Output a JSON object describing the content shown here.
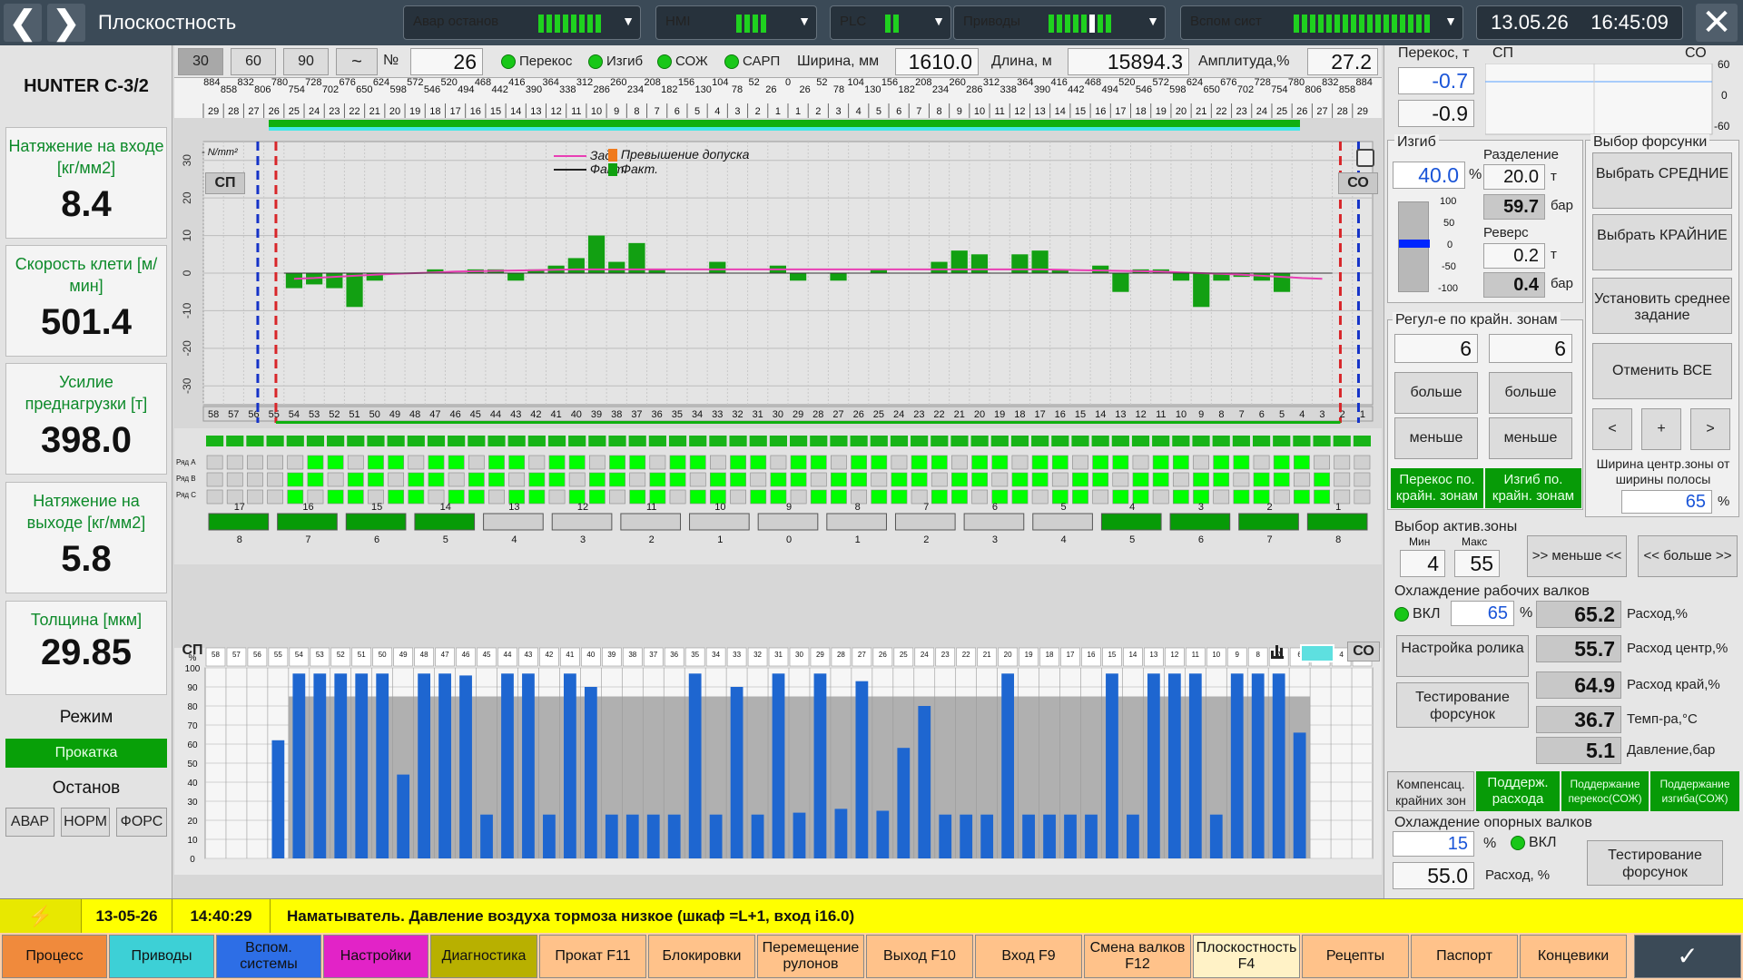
{
  "topbar": {
    "title": "Плоскостность",
    "stat_alarm": "Авар останов",
    "stat_hmi": "HMI",
    "stat_plc": "PLC",
    "stat_drives": "Приводы",
    "stat_aux": "Вспом сист",
    "date": "13.05.26",
    "time": "16:45:09"
  },
  "left": {
    "mill": "HUNTER C-3/2",
    "cards": [
      {
        "label": "Натяжение на входе [кг/мм2]",
        "value": "8.4"
      },
      {
        "label": "Скорость клети [м/мин]",
        "value": "501.4"
      },
      {
        "label": "Усилие преднагрузки [т]",
        "value": "398.0"
      },
      {
        "label": "Натяжение на выходе [кг/мм2]",
        "value": "5.8"
      },
      {
        "label": "Толщина [мкм]",
        "value": "29.85"
      }
    ],
    "mode_title": "Режим",
    "mode_value": "Прокатка",
    "stop_title": "Останов",
    "stop_buttons": [
      "АВАР",
      "НОРМ",
      "ФОРС"
    ]
  },
  "toolbar": {
    "b30": "30",
    "b60": "60",
    "b90": "90",
    "tilde": "~",
    "no_label": "№",
    "no_value": "26",
    "ind": [
      "Перекос",
      "Изгиб",
      "СОЖ",
      "САРП"
    ],
    "width_label": "Ширина, мм",
    "width_value": "1610.0",
    "length_label": "Длина, м",
    "length_value": "15894.3",
    "amp_label": "Амплитуда,%",
    "amp_value": "27.2"
  },
  "chart": {
    "sp": "СП",
    "so": "СО",
    "unit": "- N/mm²",
    "leg_set": "Зад.",
    "leg_act": "Факт.",
    "leg_over": "Превышение допуска",
    "leg_fact": "Факт.",
    "ylim": [
      -35,
      35
    ],
    "yticks": [
      "30",
      "20",
      "10",
      "0",
      "-10",
      "-20",
      "-30"
    ],
    "top_widths": [
      "884",
      "858",
      "832",
      "806",
      "780",
      "754",
      "728",
      "702",
      "676",
      "650",
      "624",
      "598",
      "572",
      "546",
      "520",
      "494",
      "468",
      "442",
      "416",
      "390",
      "364",
      "338",
      "312",
      "286",
      "260",
      "234",
      "208",
      "182",
      "156",
      "130",
      "104",
      "78",
      "52",
      "26",
      "0",
      "26",
      "52",
      "78",
      "104",
      "130",
      "156",
      "182",
      "208",
      "234",
      "260",
      "286",
      "312",
      "338",
      "364",
      "390",
      "416",
      "442",
      "468",
      "494",
      "520",
      "546",
      "572",
      "598",
      "624",
      "650",
      "676",
      "702",
      "728",
      "754",
      "780",
      "806",
      "832",
      "858",
      "884"
    ],
    "top_zones": [
      "29",
      "28",
      "27",
      "26",
      "25",
      "24",
      "23",
      "22",
      "21",
      "20",
      "19",
      "18",
      "17",
      "16",
      "15",
      "14",
      "13",
      "12",
      "11",
      "10",
      "9",
      "8",
      "7",
      "6",
      "5",
      "4",
      "3",
      "2",
      "1",
      "1",
      "2",
      "3",
      "4",
      "5",
      "6",
      "7",
      "8",
      "9",
      "10",
      "11",
      "12",
      "13",
      "14",
      "15",
      "16",
      "17",
      "18",
      "19",
      "20",
      "21",
      "22",
      "23",
      "24",
      "25",
      "26",
      "27",
      "28",
      "29"
    ],
    "zones": [
      "58",
      "57",
      "56",
      "55",
      "54",
      "53",
      "52",
      "51",
      "50",
      "49",
      "48",
      "47",
      "46",
      "45",
      "44",
      "43",
      "42",
      "41",
      "40",
      "39",
      "38",
      "37",
      "36",
      "35",
      "34",
      "33",
      "32",
      "31",
      "30",
      "29",
      "28",
      "27",
      "26",
      "25",
      "24",
      "23",
      "22",
      "21",
      "20",
      "19",
      "18",
      "17",
      "16",
      "15",
      "14",
      "13",
      "12",
      "11",
      "10",
      "9",
      "8",
      "7",
      "6",
      "5",
      "4",
      "3",
      "2",
      "1"
    ],
    "values": [
      0,
      0,
      0,
      0,
      -4,
      -3,
      -4,
      -9,
      -2,
      0,
      0,
      1,
      0,
      1,
      1,
      -2,
      1,
      2,
      4,
      10,
      3,
      8,
      1,
      0,
      0,
      3,
      0,
      0,
      2,
      -2,
      0,
      -2,
      0,
      1,
      0,
      0,
      3,
      6,
      5,
      0,
      5,
      6,
      1,
      0,
      2,
      -5,
      1,
      1,
      -2,
      -9,
      -2,
      -1,
      -2,
      -5,
      0,
      0,
      0,
      0
    ],
    "setpoint": [
      0,
      0,
      0,
      0,
      -1.5,
      -1.3,
      -1.0,
      -0.7,
      -0.4,
      -0.2,
      0.0,
      0.2,
      0.4,
      0.5,
      0.6,
      0.7,
      0.8,
      0.9,
      1.0,
      1.0,
      1.0,
      1.0,
      1.0,
      1.0,
      1.0,
      1.0,
      1.0,
      1.0,
      1.0,
      1.0,
      1.0,
      1.0,
      1.0,
      1.0,
      1.0,
      1.0,
      1.0,
      1.0,
      1.0,
      1.0,
      1.0,
      1.0,
      0.9,
      0.8,
      0.7,
      0.6,
      0.5,
      0.4,
      0.2,
      0.0,
      -0.2,
      -0.4,
      -0.7,
      -1.0,
      -1.3,
      -1.5,
      0,
      0
    ]
  },
  "valves": {
    "row_labels": [
      "Ряд А",
      "Ряд В",
      "Ряд С"
    ],
    "groups": [
      "17",
      "16",
      "15",
      "14",
      "13",
      "12",
      "11",
      "10",
      "9",
      "8",
      "7",
      "6",
      "5",
      "4",
      "3",
      "2",
      "1"
    ],
    "sub": [
      "8",
      "7",
      "6",
      "5",
      "4",
      "3",
      "2",
      "1",
      "0",
      "1",
      "2",
      "3",
      "4",
      "5",
      "6",
      "7",
      "8"
    ],
    "sp": "СП",
    "so": "СО"
  },
  "bars": {
    "yticks": [
      "100",
      "90",
      "80",
      "70",
      "60",
      "50",
      "40",
      "30",
      "20",
      "10",
      "0"
    ],
    "pct": "%",
    "values": [
      0,
      0,
      0,
      62,
      97,
      97,
      97,
      97,
      97,
      44,
      97,
      97,
      96,
      23,
      97,
      97,
      23,
      97,
      90,
      23,
      23,
      23,
      23,
      97,
      23,
      90,
      23,
      97,
      24,
      97,
      26,
      93,
      25,
      58,
      80,
      23,
      23,
      23,
      97,
      23,
      23,
      23,
      23,
      97,
      23,
      97,
      97,
      97,
      23,
      97,
      97,
      97,
      66,
      0,
      0,
      0
    ]
  },
  "right": {
    "tilt_title": "Перекос, т",
    "tilt_v1": "-0.7",
    "tilt_v2": "-0.9",
    "sp": "СП",
    "so": "СО",
    "mini_ticks": [
      "60",
      "0",
      "-60"
    ],
    "bend_title": "Изгиб",
    "bend_pct": "40.0",
    "pct": "%",
    "bend_ticks": [
      "100",
      "50",
      "0",
      "-50",
      "-100"
    ],
    "bend_level": 40,
    "sep_title": "Разделение",
    "sep_t": "20.0",
    "t": "т",
    "sep_bar": "59.7",
    "bar": "бар",
    "rev_title": "Реверс",
    "rev_t": "0.2",
    "rev_bar": "0.4",
    "nozzle_title": "Выбор форсунки",
    "nozzle_btns": [
      "Выбрать СРЕДНИЕ",
      "Выбрать КРАЙНИЕ",
      "Установить среднее задание",
      "Отменить ВСЕ"
    ],
    "arrows": [
      "<",
      "+",
      ">"
    ],
    "center_label": "Ширина центр.зоны от ширины полосы",
    "center_value": "65",
    "edge_title": "Регул-е по крайн. зонам",
    "edge_v1": "6",
    "edge_v2": "6",
    "more": "больше",
    "less": "меньше",
    "edge_tilt": "Перекос по. крайн. зонам",
    "edge_bend": "Изгиб по. крайн. зонам",
    "active_title": "Выбор актив.зоны",
    "min_l": "Мин",
    "max_l": "Макс",
    "min_v": "4",
    "max_v": "55",
    "less_btn": ">> меньше <<",
    "more_btn": "<< больше >>",
    "work_title": "Охлаждение рабочих валков",
    "on": "ВКЛ",
    "work_pct": "65",
    "flow": "65.2",
    "flow_l": "Расход,%",
    "flow_c": "55.7",
    "flow_c_l": "Расход центр,%",
    "flow_e": "64.9",
    "flow_e_l": "Расход край,%",
    "temp": "36.7",
    "temp_l": "Темп-ра,°C",
    "press": "5.1",
    "press_l": "Давление,бар",
    "roller": "Настройка ролика",
    "test": "Тестирование форсунок",
    "modes": [
      "Компенсац. крайних зон",
      "Поддерж. расхода",
      "Поддержание перекос(СОЖ)",
      "Поддержание изгиба(СОЖ)"
    ],
    "backup_title": "Охлаждение опорных валков",
    "backup_pct": "15",
    "backup_flow": "55.0",
    "backup_flow_l": "Расход, %",
    "backup_test": "Тестирование форсунок"
  },
  "status": {
    "date": "13-05-26",
    "time": "14:40:29",
    "message": "Наматыватель. Давление воздуха тормоза низкое (шкаф =L+1, вход i16.0)"
  },
  "tabs": [
    "Процесс",
    "Приводы",
    "Вспом. системы",
    "Настройки",
    "Диагностика",
    "Прокат F11",
    "Блокировки",
    "Перемещение рулонов",
    "Выход F10",
    "Вход F9",
    "Смена валков F12",
    "Плоскостность F4",
    "Рецепты",
    "Паспорт",
    "Концевики"
  ],
  "colors": {
    "green": "#079b07",
    "bar": "#1e66d0",
    "pink": "#e83fb4",
    "topbar": "#3b4a57"
  }
}
